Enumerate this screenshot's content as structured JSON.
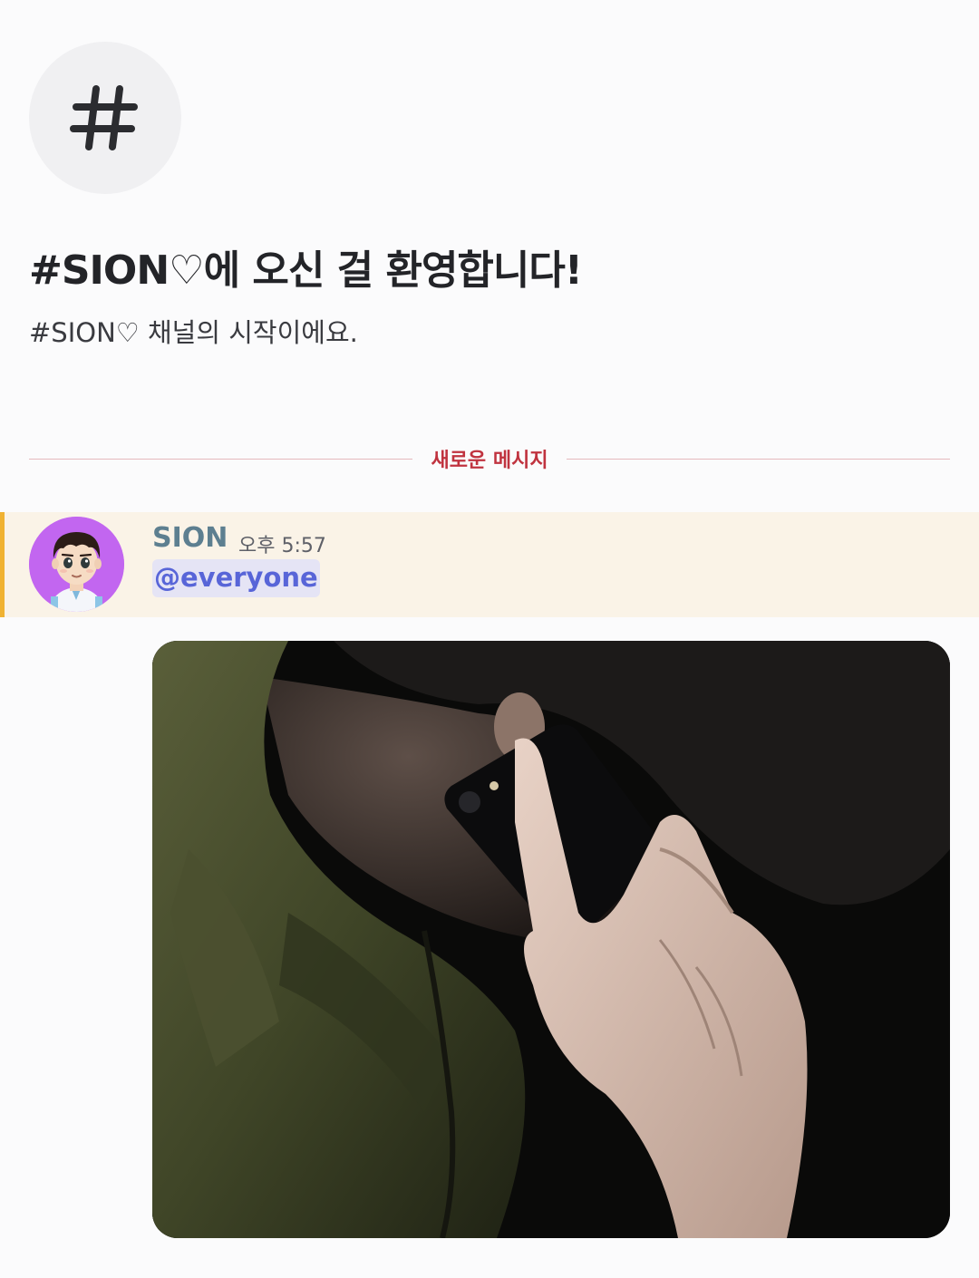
{
  "channel": {
    "icon": "hash-icon",
    "welcome_title": "#SION♡에 오신 걸 환영합니다!",
    "welcome_subtitle": "#SION♡ 채널의 시작이에요."
  },
  "divider": {
    "label": "새로운 메시지"
  },
  "message": {
    "author": "SION",
    "timestamp": "오후 5:57",
    "mention": "@everyone",
    "avatar_icon": "user-avatar-icon",
    "highlight_color": "#f0b232",
    "attachment_icon": "photo-attachment-icon"
  },
  "colors": {
    "background": "#fbfbfc",
    "new_message_red": "#c0333f",
    "author_color": "#5d7f90",
    "mention_color": "#5865d8",
    "avatar_bg": "#c266f0"
  }
}
